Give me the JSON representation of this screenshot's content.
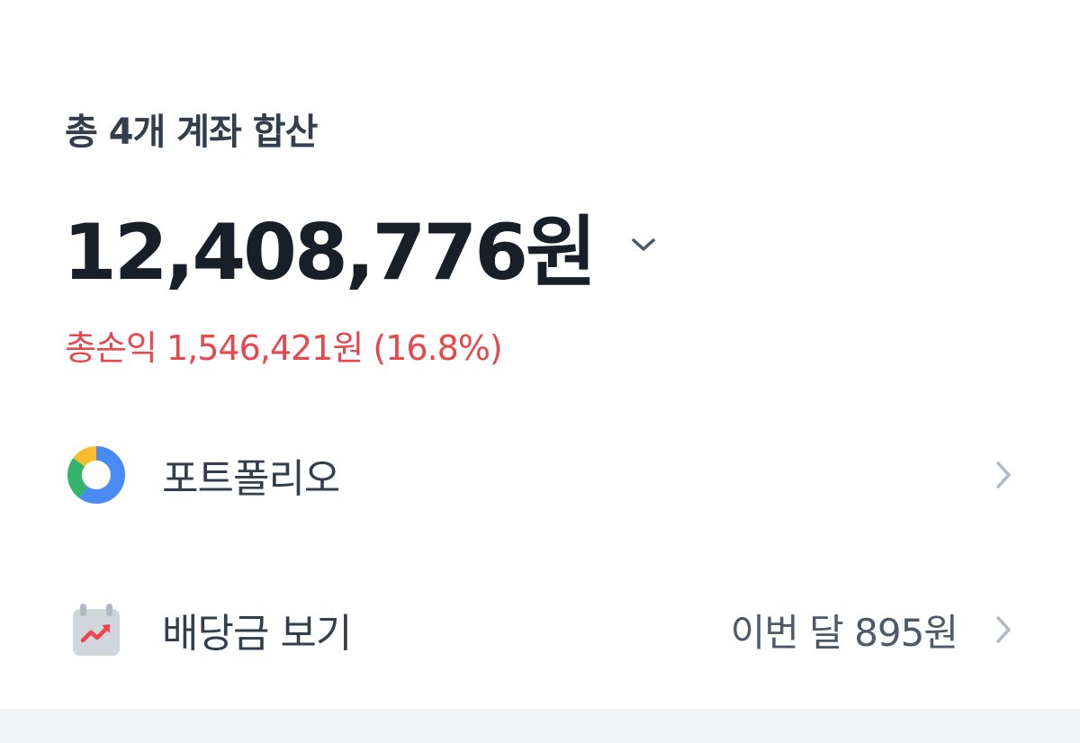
{
  "summary": {
    "accounts_label": "총 4개 계좌 합산",
    "total_amount": "12,408,776원",
    "profit_text": "총손익 1,546,421원 (16.8%)"
  },
  "menu": {
    "portfolio": {
      "label": "포트폴리오",
      "icon": "donut-chart-icon"
    },
    "dividend": {
      "label": "배당금 보기",
      "value": "이번 달 895원",
      "icon": "calendar-trend-icon"
    }
  },
  "colors": {
    "title": "#333d4b",
    "amount": "#191f28",
    "profit": "#e5484d",
    "secondary": "#4e5968",
    "chevron": "#b0b8c1",
    "band": "#f2f4f6",
    "donut_blue": "#4a8af4",
    "donut_green": "#34b36a",
    "donut_yellow": "#f9bc2c",
    "calendar_gray": "#d1d6db",
    "trend_red": "#f04452"
  }
}
